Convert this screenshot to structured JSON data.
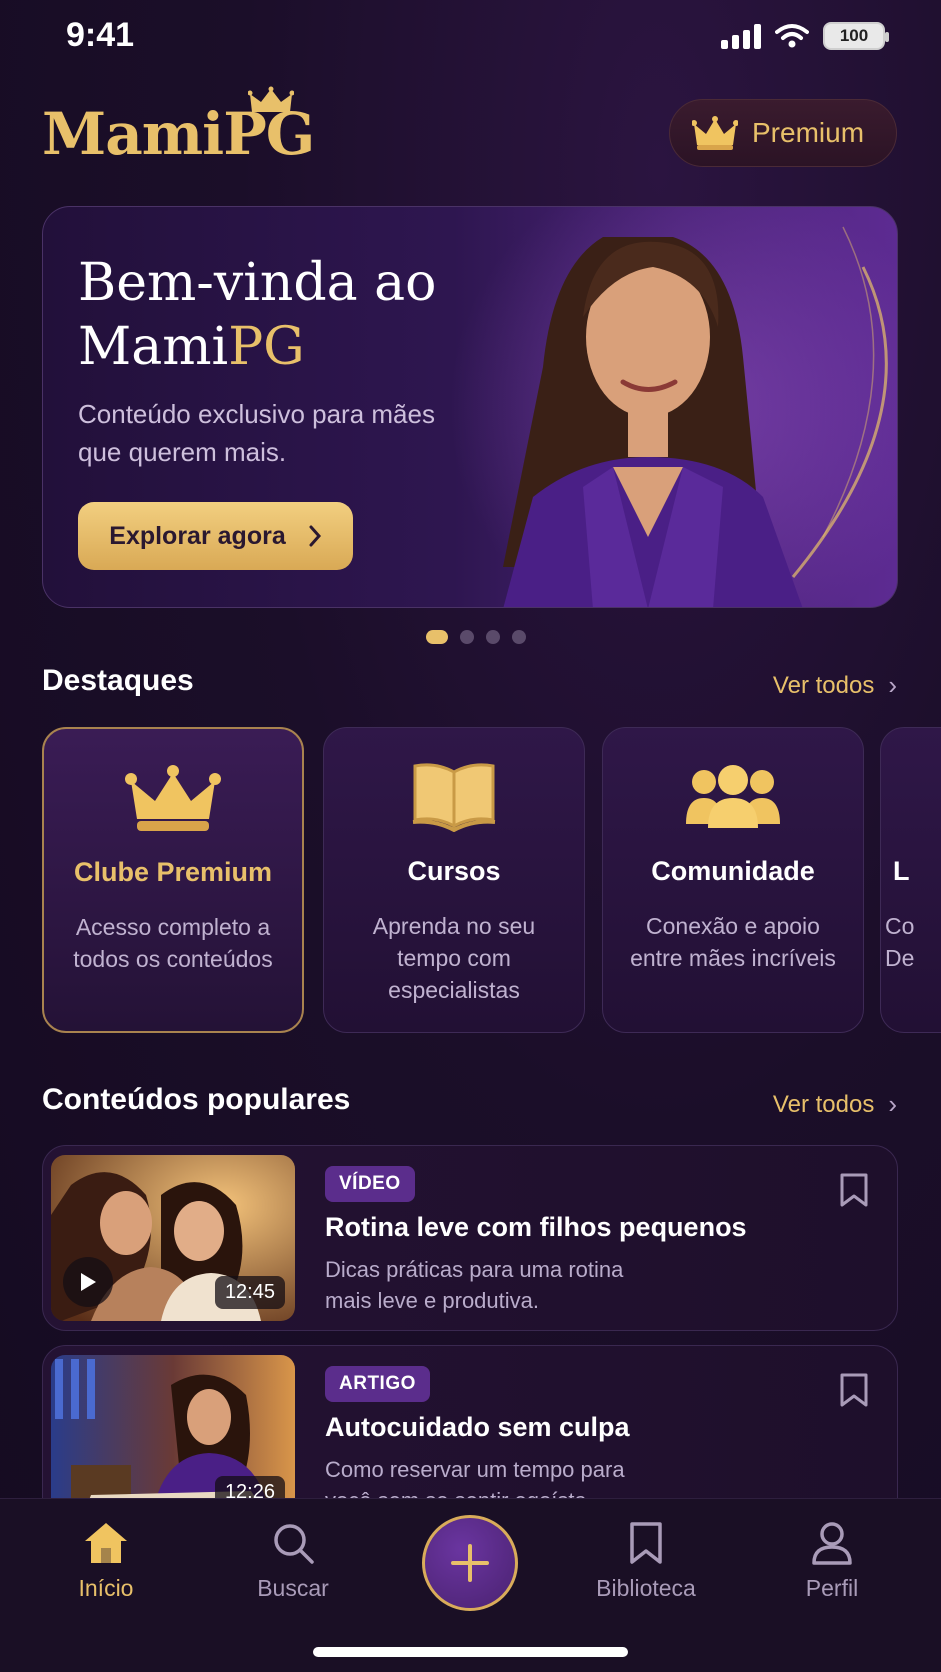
{
  "status_bar": {
    "time": "9:41",
    "battery": "100"
  },
  "header": {
    "logo_prefix": "Mami",
    "logo_suffix": "PG",
    "premium_label": "Premium"
  },
  "hero": {
    "title_line1": "Bem-vinda ao",
    "title_line2_prefix": "Mami",
    "title_line2_suffix": "PG",
    "subtitle": "Conteúdo exclusivo para mães que querem mais.",
    "cta_label": "Explorar agora"
  },
  "carousel": {
    "total": 4,
    "active": 1
  },
  "highlights": {
    "title": "Destaques",
    "see_all": "Ver todos",
    "cards": [
      {
        "title": "Clube Premium",
        "desc": "Acesso completo a todos os conteúdos",
        "icon": "crown-icon"
      },
      {
        "title": "Cursos",
        "desc": "Aprenda no seu tempo com especialistas",
        "icon": "book-icon"
      },
      {
        "title": "Comunidade",
        "desc": "Conexão e apoio entre mães incríveis",
        "icon": "group-icon"
      },
      {
        "title": "L",
        "desc": "Co De",
        "icon": ""
      }
    ]
  },
  "popular": {
    "title": "Conteúdos populares",
    "see_all": "Ver todos",
    "items": [
      {
        "badge": "VÍDEO",
        "title": "Rotina leve com filhos pequenos",
        "desc": "Dicas práticas para uma rotina mais leve e produtiva.",
        "duration": "12:45"
      },
      {
        "badge": "ARTIGO",
        "title": "Autocuidado sem culpa",
        "desc": "Como reservar um tempo para você sem se sentir egoísta.",
        "duration": "12:26"
      }
    ]
  },
  "nav": {
    "items": [
      {
        "label": "Início",
        "icon": "home-icon"
      },
      {
        "label": "Buscar",
        "icon": "search-icon"
      },
      {
        "label": "Biblioteca",
        "icon": "bookmark-icon"
      },
      {
        "label": "Perfil",
        "icon": "user-icon"
      }
    ],
    "add_icon": "plus-icon"
  },
  "colors": {
    "gold": "#e8c06a",
    "purple": "#5b2d8c",
    "background": "#1b0e29"
  }
}
